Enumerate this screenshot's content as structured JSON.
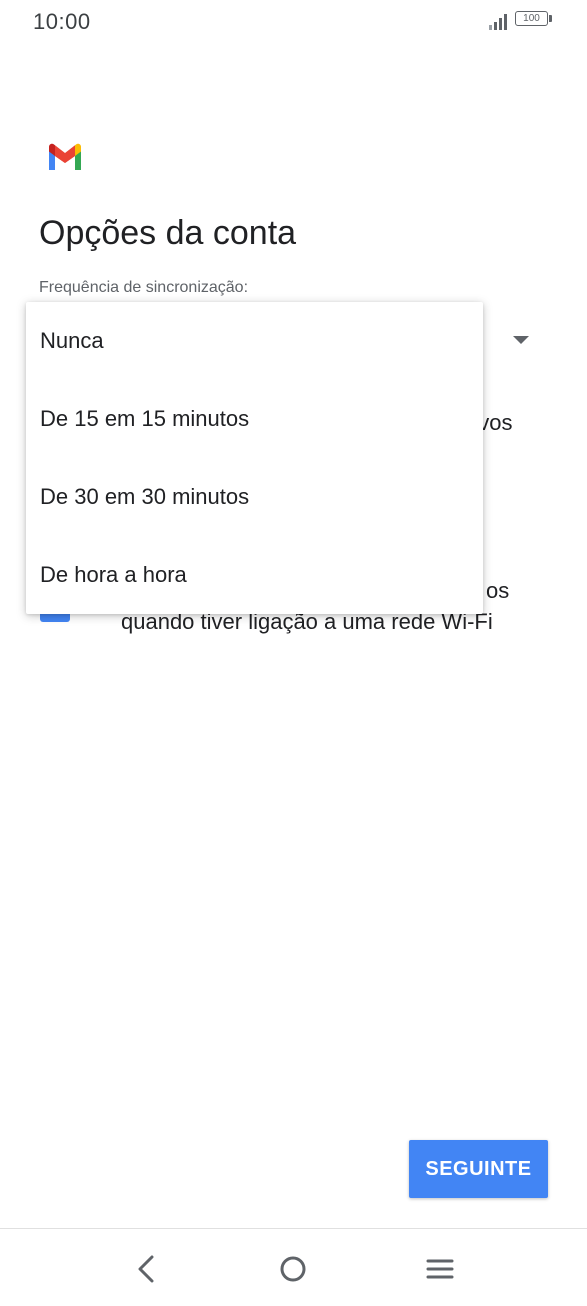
{
  "status_bar": {
    "time": "10:00",
    "battery": "100"
  },
  "icons": {
    "app_logo": "gmail-logo",
    "signal": "signal-icon",
    "battery": "battery-icon",
    "dropdown": "triangle-down-icon",
    "back": "back-chevron-icon",
    "home": "home-circle-icon",
    "menu": "menu-lines-icon"
  },
  "page": {
    "title": "Opções da conta",
    "sync_label": "Frequência de sincronização:"
  },
  "dropdown": {
    "options": [
      "Nunca",
      "De 15 em 15 minutos",
      "De 30 em 30 minutos",
      "De hora a hora"
    ]
  },
  "background": {
    "notify_fragment": "ovos",
    "download_fragment_1": "os",
    "download_fragment_2": "quando tiver ligação a uma rede Wi-Fi"
  },
  "actions": {
    "next_label": "SEGUINTE"
  },
  "colors": {
    "accent": "#4285f4",
    "text_primary": "#202124",
    "text_secondary": "#5f6368"
  }
}
